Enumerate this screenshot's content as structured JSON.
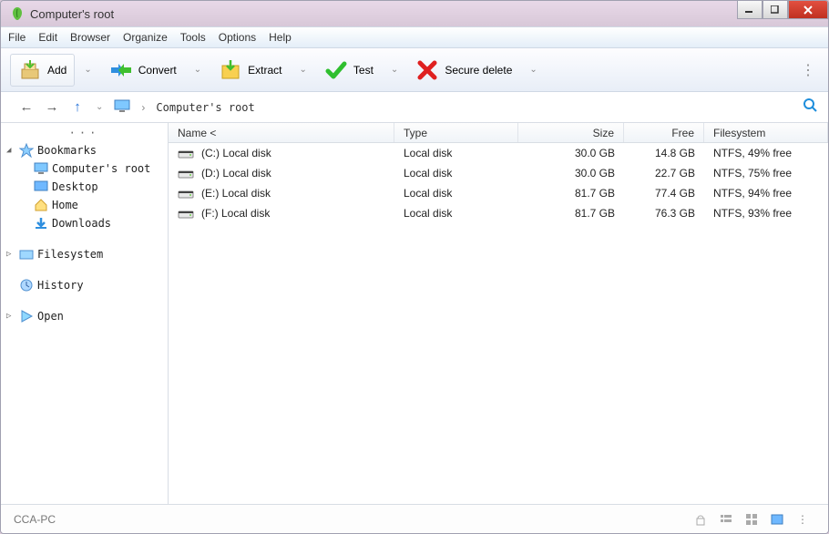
{
  "window": {
    "title": "Computer's root"
  },
  "menubar": {
    "file": "File",
    "edit": "Edit",
    "browser": "Browser",
    "organize": "Organize",
    "tools": "Tools",
    "options": "Options",
    "help": "Help"
  },
  "toolbar": {
    "add": "Add",
    "convert": "Convert",
    "extract": "Extract",
    "test": "Test",
    "secure_delete": "Secure delete"
  },
  "breadcrumb": {
    "path": "Computer's root"
  },
  "sidebar": {
    "bookmarks": "Bookmarks",
    "bookmarks_items": {
      "computers_root": "Computer's root",
      "desktop": "Desktop",
      "home": "Home",
      "downloads": "Downloads"
    },
    "filesystem": "Filesystem",
    "history": "History",
    "open": "Open"
  },
  "list": {
    "headers": {
      "name": "Name <",
      "type": "Type",
      "size": "Size",
      "free": "Free",
      "filesystem": "Filesystem"
    },
    "rows": [
      {
        "name": "(C:) Local disk",
        "type": "Local disk",
        "size": "30.0 GB",
        "free": "14.8 GB",
        "fs": "NTFS, 49% free"
      },
      {
        "name": "(D:) Local disk",
        "type": "Local disk",
        "size": "30.0 GB",
        "free": "22.7 GB",
        "fs": "NTFS, 75% free"
      },
      {
        "name": "(E:) Local disk",
        "type": "Local disk",
        "size": "81.7 GB",
        "free": "77.4 GB",
        "fs": "NTFS, 94% free"
      },
      {
        "name": "(F:) Local disk",
        "type": "Local disk",
        "size": "81.7 GB",
        "free": "76.3 GB",
        "fs": "NTFS, 93% free"
      }
    ]
  },
  "statusbar": {
    "host": "CCA-PC"
  }
}
